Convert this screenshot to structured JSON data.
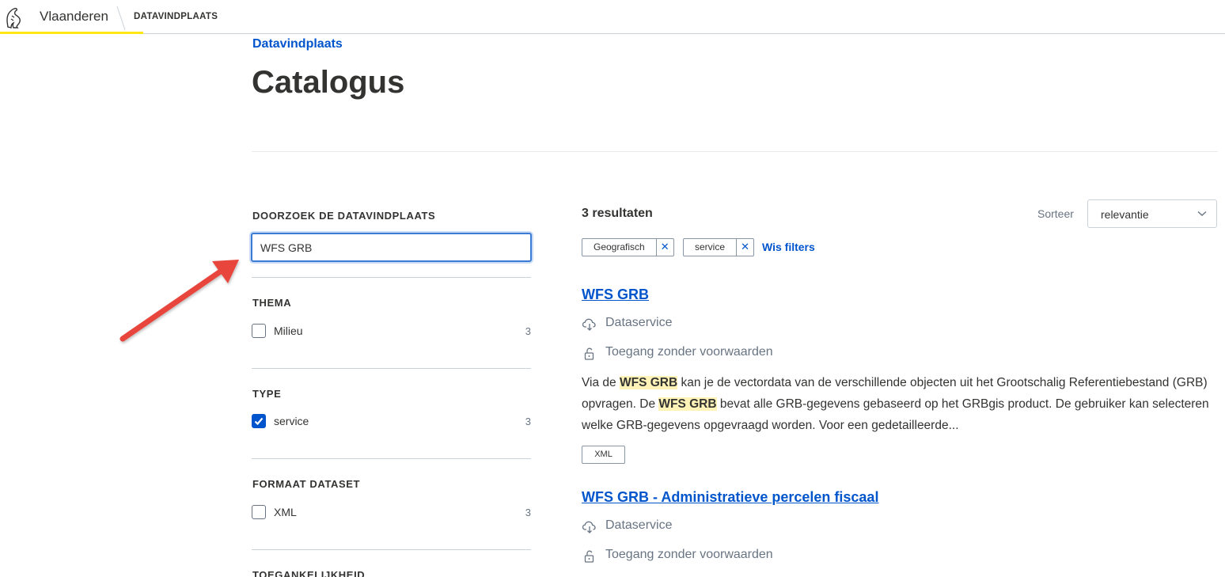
{
  "header": {
    "brand": "Vlaanderen",
    "site": "DATAVINDPLAATS"
  },
  "breadcrumb": "Datavindplaats",
  "page_title": "Catalogus",
  "search": {
    "label": "DOORZOEK DE DATAVINDPLAATS",
    "value": "WFS GRB"
  },
  "filters": [
    {
      "heading": "THEMA",
      "option": "Milieu",
      "count": "3",
      "checked": false
    },
    {
      "heading": "TYPE",
      "option": "service",
      "count": "3",
      "checked": true
    },
    {
      "heading": "FORMAAT DATASET",
      "option": "XML",
      "count": "3",
      "checked": false
    },
    {
      "heading": "TOEGANKELIJKHEID"
    }
  ],
  "results": {
    "count_label": "3 resultaten",
    "sort_label": "Sorteer",
    "sort_value": "relevantie",
    "active_filters": [
      "Geografisch",
      "service"
    ],
    "clear_filters": "Wis filters",
    "items": [
      {
        "title": "WFS GRB",
        "type": "Dataservice",
        "access": "Toegang zonder voorwaarden",
        "description": {
          "p1": "Via de ",
          "h1": "WFS GRB",
          "p2": " kan je de vectordata van de verschillende objecten uit het Grootschalig Referentiebestand (GRB) opvragen. De ",
          "h2": "WFS GRB",
          "p3": " bevat alle GRB-gegevens gebaseerd op het GRBgis product. De gebruiker kan selecteren welke GRB-gegevens opgevraagd worden. Voor een gedetailleerde..."
        },
        "tag": "XML"
      },
      {
        "title": "WFS GRB - Administratieve percelen fiscaal",
        "type": "Dataservice",
        "access": "Toegang zonder voorwaarden"
      }
    ]
  },
  "colors": {
    "link": "#0055cc",
    "brand_yellow": "#ffe615",
    "annotation_arrow": "#e8453c",
    "highlight": "#fff3b8"
  },
  "icons": [
    "lion-logo-icon",
    "chevron-down-icon",
    "close-icon",
    "cloud-download-icon",
    "unlock-icon",
    "checkmark-icon",
    "annotation-arrow"
  ]
}
